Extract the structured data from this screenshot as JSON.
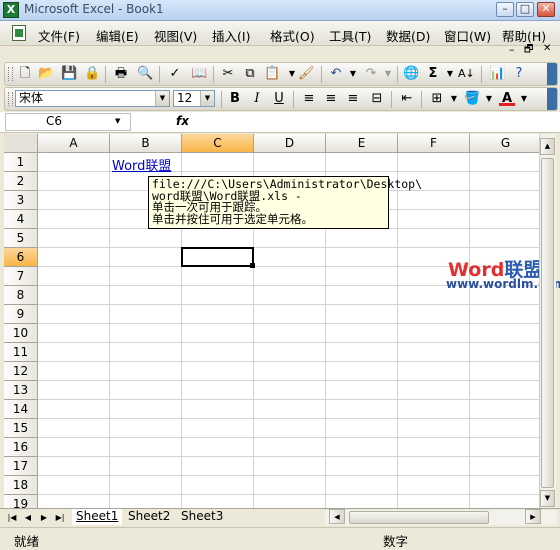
{
  "window": {
    "title": "Microsoft Excel - Book1",
    "controls": {
      "minimize": "–",
      "maximize": "□",
      "close": "✕"
    }
  },
  "menu": {
    "items": [
      "文件(F)",
      "编辑(E)",
      "视图(V)",
      "插入(I)",
      "格式(O)",
      "工具(T)",
      "数据(D)",
      "窗口(W)",
      "帮助(H)"
    ],
    "doc_controls": {
      "minimize": "–",
      "restore": "🗗",
      "close": "✕"
    }
  },
  "formatting": {
    "font_name": "宋体",
    "font_size": "12",
    "bold": "B",
    "italic": "I",
    "underline": "U"
  },
  "formula_bar": {
    "name_box": "C6",
    "fx": "fx",
    "content": ""
  },
  "grid": {
    "columns": [
      "A",
      "B",
      "C",
      "D",
      "E",
      "F",
      "G"
    ],
    "rows": [
      "1",
      "2",
      "3",
      "4",
      "5",
      "6",
      "7",
      "8",
      "9",
      "10",
      "11",
      "12",
      "13",
      "14",
      "15",
      "16",
      "17",
      "18",
      "19"
    ],
    "selected_column": "C",
    "selected_row": "6",
    "cells": {
      "B1": "Word联盟"
    }
  },
  "tooltip": {
    "lines": [
      "file:///C:\\Users\\Administrator\\Desktop\\",
      "word联盟\\Word联盟.xls -",
      "单击一次可用于跟踪。",
      "单击并按住可用于选定单元格。"
    ]
  },
  "watermark": {
    "word": "Word",
    "lianmeng": "联盟",
    "url": "www.wordlm.com"
  },
  "sheets": {
    "tabs": [
      "Sheet1",
      "Sheet2",
      "Sheet3"
    ],
    "active": "Sheet1"
  },
  "status": {
    "left": "就绪",
    "right": "数字"
  },
  "colors": {
    "selected_header": "#f8b548",
    "hyperlink": "#0000cc",
    "tooltip_bg": "#ffffe1"
  }
}
